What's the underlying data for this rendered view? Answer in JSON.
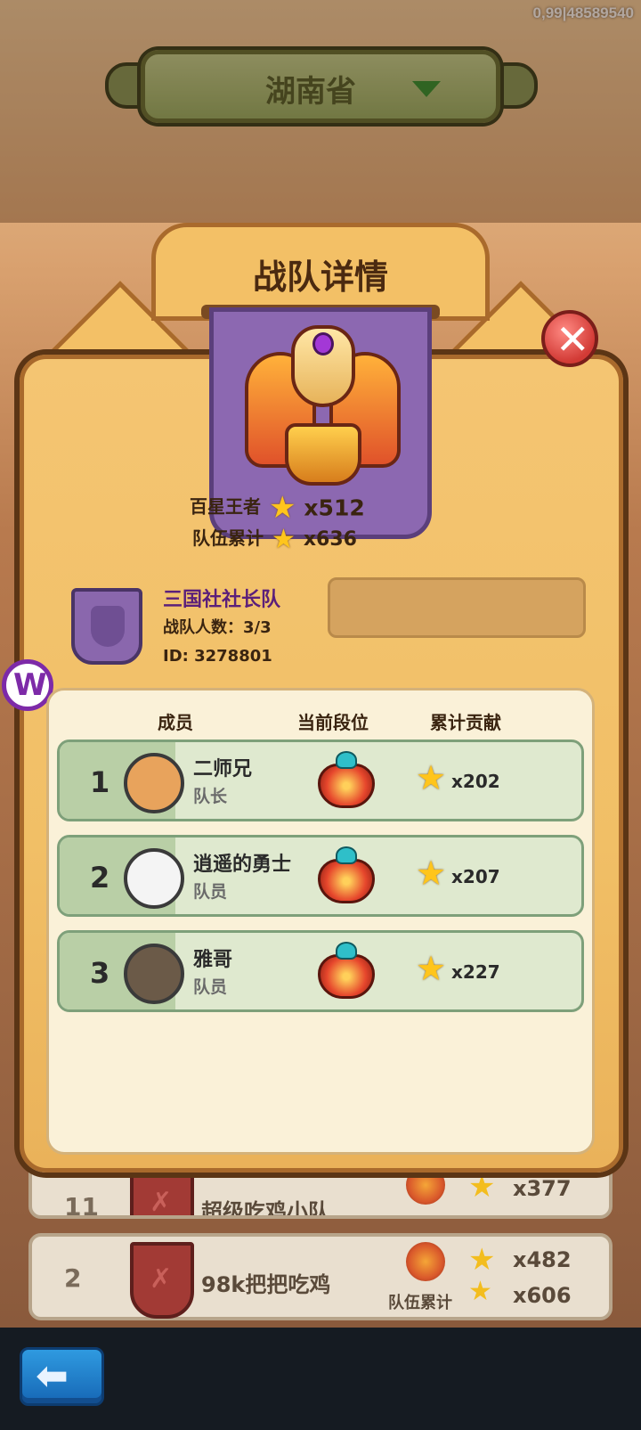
{
  "corner_id": "0,99|48589540",
  "province": {
    "label": "湖南省"
  },
  "panel": {
    "title": "战队详情"
  },
  "team": {
    "stat1_label": "百星王者",
    "stat1_value": "x512",
    "stat2_label": "队伍累计",
    "stat2_value": "x636",
    "name": "三国社社长队",
    "count": "战队人数：3/3",
    "id": "ID: 3278801"
  },
  "columns": {
    "member": "成员",
    "rank": "当前段位",
    "contribution": "累计贡献"
  },
  "members": [
    {
      "rank": "1",
      "name": "二师兄",
      "role": "队长",
      "value": "x202",
      "avatar_color": "#e8a35c"
    },
    {
      "rank": "2",
      "name": "逍遥的勇士",
      "role": "队员",
      "value": "x207",
      "avatar_color": "#f4f4f4"
    },
    {
      "rank": "3",
      "name": "雅哥",
      "role": "队员",
      "value": "x227",
      "avatar_color": "#6b5a48"
    }
  ],
  "background_rows": [
    {
      "rank": "11",
      "name": "超级吃鸡小队",
      "value": "x377"
    },
    {
      "rank": "2",
      "name": "98k把把吃鸡",
      "value": "x482",
      "sub_label": "队伍累计",
      "sub_value": "x606"
    }
  ],
  "icons": {
    "star": "star-icon",
    "close": "close-icon",
    "back": "back-arrow-icon",
    "dropdown": "dropdown-triangle-icon",
    "logo": "w-logo"
  },
  "colors": {
    "panel": "#f1bf66",
    "banner": "#8c68b1",
    "row": "#dfe9cf",
    "close": "#d23a35"
  }
}
